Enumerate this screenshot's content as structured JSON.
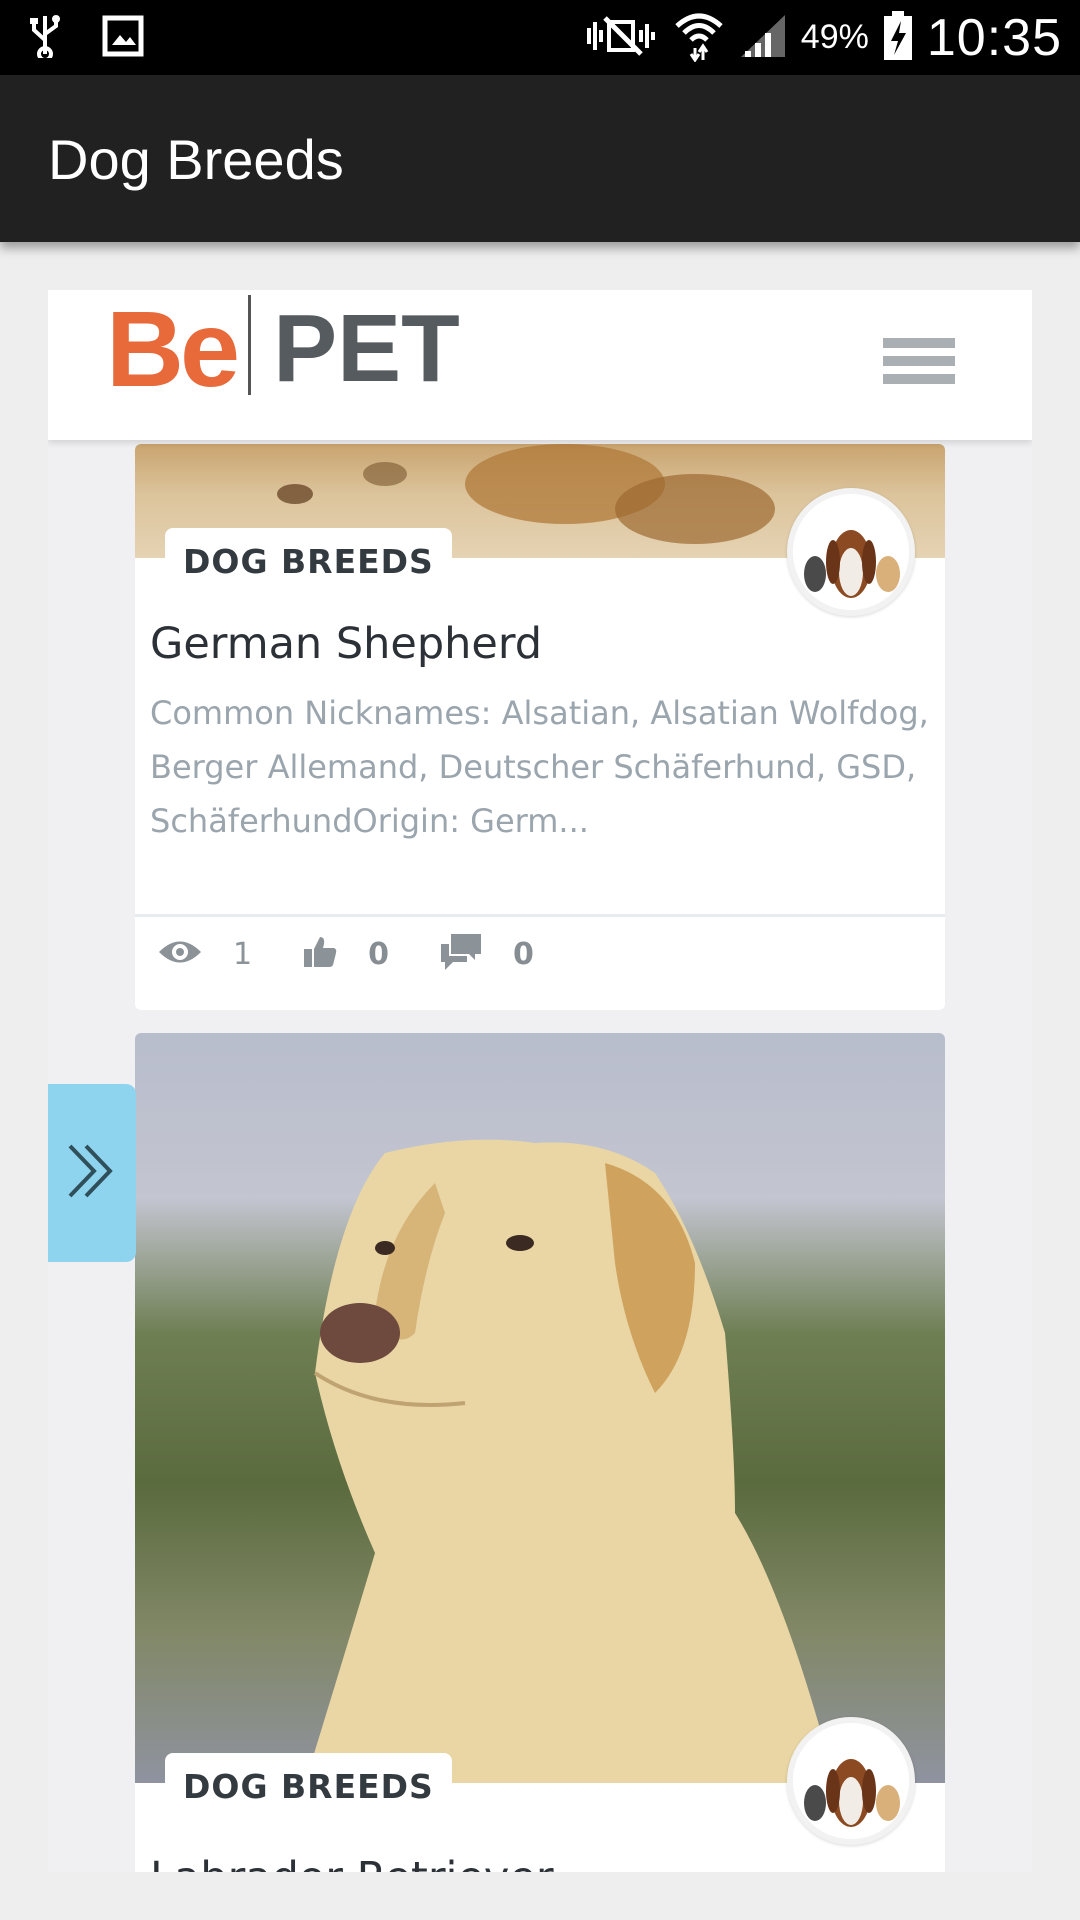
{
  "status_bar": {
    "battery_percent": "49%",
    "time": "10:35",
    "icons": [
      "usb-icon",
      "image-icon",
      "mute-icon",
      "wifi-icon",
      "signal-icon",
      "battery-charging-icon"
    ]
  },
  "app_bar": {
    "title": "Dog Breeds"
  },
  "site_header": {
    "logo_left": "Be",
    "logo_right": "PET",
    "menu_icon": "hamburger-menu-icon",
    "logo_colors": {
      "be": "#e86a3a",
      "pet": "#555b5e"
    }
  },
  "side_tab": {
    "icon": "double-chevron-right-icon",
    "color": "#8fd4ee"
  },
  "cards": [
    {
      "category": "DOG BREEDS",
      "title": "German Shepherd",
      "excerpt": "Common Nicknames: Alsatian, Alsatian Wolfdog, Berger Allemand, Deutscher Schäferhund, GSD, SchäferhundOrigin: Germ...",
      "stats": {
        "views": "1",
        "likes": "0",
        "comments": "0"
      }
    },
    {
      "category": "DOG BREEDS",
      "title": "Labrador Retriever"
    }
  ]
}
